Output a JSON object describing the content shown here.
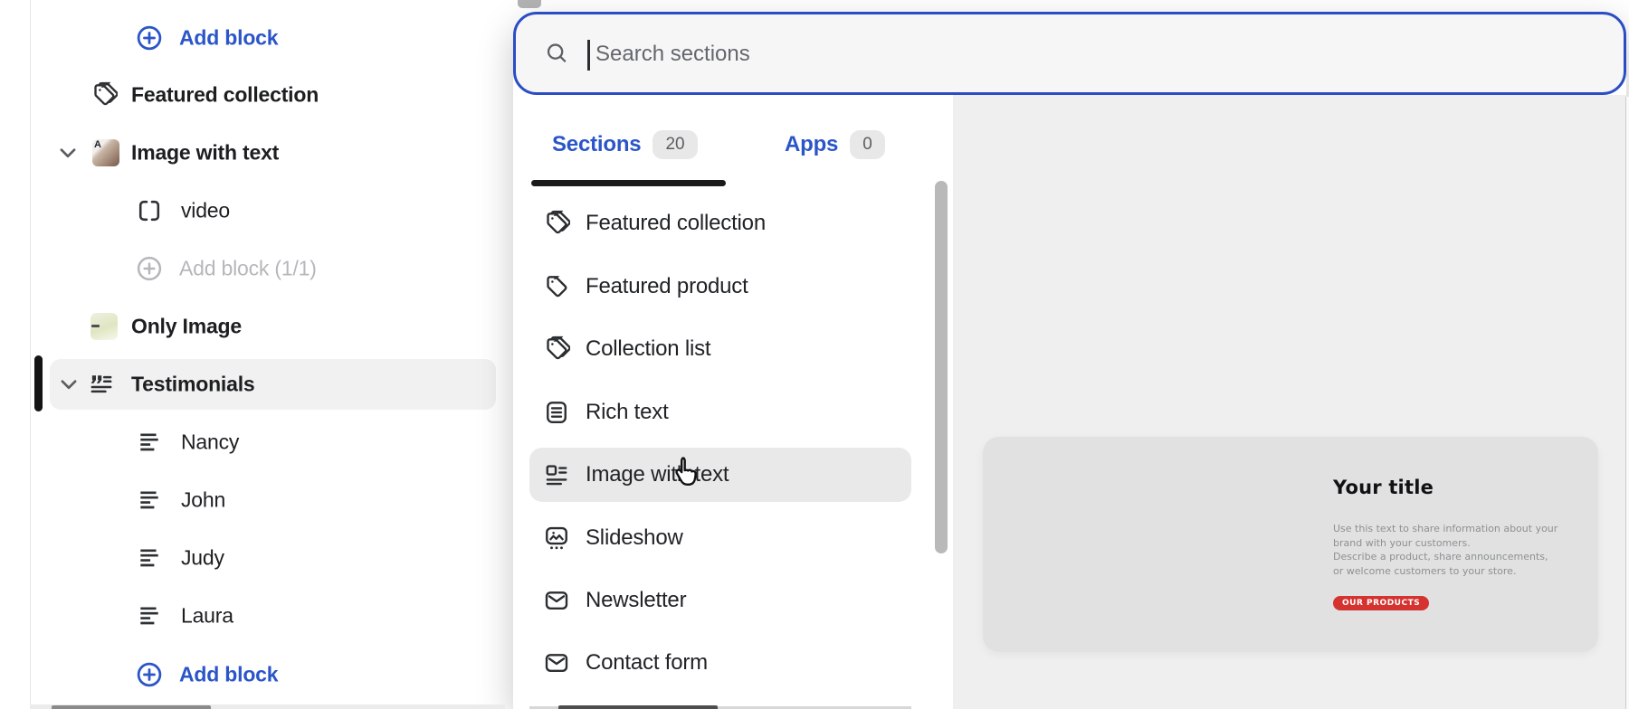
{
  "sidebar": {
    "items": [
      {
        "label": "Add block",
        "icon": "circle-plus-icon",
        "type": "action",
        "state": "enabled"
      },
      {
        "label": "Featured collection",
        "icon": "tags-icon",
        "type": "section"
      },
      {
        "label": "Image with text",
        "icon": "image-thumbnail",
        "type": "section",
        "expanded": true
      },
      {
        "label": "video",
        "icon": "frame-brackets-icon",
        "type": "block"
      },
      {
        "label": "Add block (1/1)",
        "icon": "circle-plus-icon",
        "type": "action",
        "state": "disabled"
      },
      {
        "label": "Only Image",
        "icon": "image-thumbnail",
        "type": "section"
      },
      {
        "label": "Testimonials",
        "icon": "quote-icon",
        "type": "section",
        "expanded": true,
        "selected": true
      },
      {
        "label": "Nancy",
        "icon": "align-left-icon",
        "type": "block"
      },
      {
        "label": "John",
        "icon": "align-left-icon",
        "type": "block"
      },
      {
        "label": "Judy",
        "icon": "align-left-icon",
        "type": "block"
      },
      {
        "label": "Laura",
        "icon": "align-left-icon",
        "type": "block"
      },
      {
        "label": "Add block",
        "icon": "circle-plus-icon",
        "type": "action",
        "state": "enabled"
      }
    ]
  },
  "modal": {
    "search": {
      "placeholder": "Search sections",
      "icon": "search-icon",
      "value": ""
    },
    "tabs": [
      {
        "label": "Sections",
        "count": "20",
        "active": true
      },
      {
        "label": "Apps",
        "count": "0",
        "active": false
      }
    ],
    "sections": [
      {
        "label": "Featured collection",
        "icon": "tags-icon"
      },
      {
        "label": "Featured product",
        "icon": "tag-icon"
      },
      {
        "label": "Collection list",
        "icon": "tags-icon"
      },
      {
        "label": "Rich text",
        "icon": "document-text-icon"
      },
      {
        "label": "Image with text",
        "icon": "image-text-layout-icon",
        "hovered": true
      },
      {
        "label": "Slideshow",
        "icon": "slideshow-icon"
      },
      {
        "label": "Newsletter",
        "icon": "envelope-icon"
      },
      {
        "label": "Contact form",
        "icon": "envelope-icon"
      }
    ],
    "preview": {
      "title": "Your title",
      "paragraphs": [
        "Use this text to share information about your brand with your customers.",
        "Describe a product, share announcements, or welcome customers to your store."
      ],
      "button_label": "OUR PRODUCTS"
    }
  },
  "colors": {
    "accent_blue": "#2b55c8",
    "search_border_blue": "#2b4dc4",
    "selected_row_bg": "#f1f1f2",
    "hovered_row_bg": "#e9e9e9",
    "preview_pane_bg": "#efeff0",
    "preview_card_bg": "#e1e1e1",
    "button_red": "#d43330",
    "tab_underline": "#1a1a1a",
    "disabled_text": "#b5b7ba"
  }
}
